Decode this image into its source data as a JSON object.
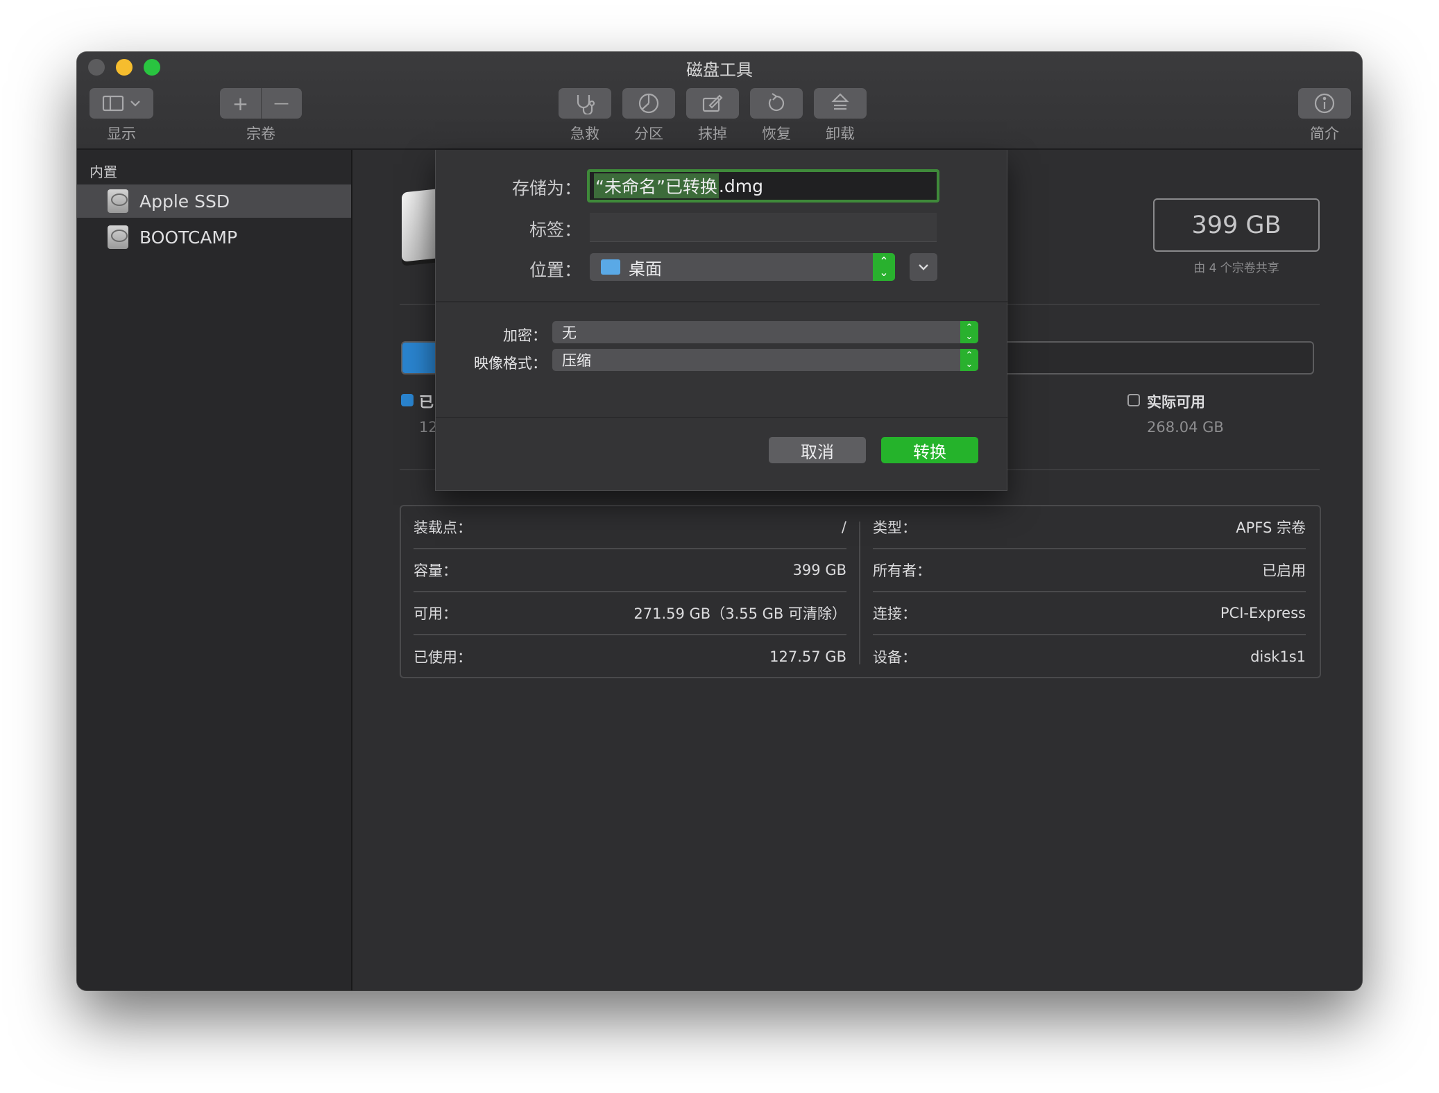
{
  "window": {
    "title": "磁盘工具"
  },
  "toolbar": {
    "view_label": "显示",
    "volume_label": "宗卷",
    "firstaid_label": "急救",
    "partition_label": "分区",
    "erase_label": "抹掉",
    "restore_label": "恢复",
    "unmount_label": "卸载",
    "info_label": "简介",
    "add_glyph": "+",
    "remove_glyph": "—"
  },
  "sidebar": {
    "section": "内置",
    "items": [
      {
        "label": "Apple SSD",
        "selected": true
      },
      {
        "label": "BOOTCAMP",
        "selected": false
      }
    ]
  },
  "volume": {
    "capacity": "399 GB",
    "shared_note": "由 4 个宗卷共享",
    "usage_fraction": 0.32,
    "used_partial": "已",
    "used_value_partial": "12",
    "available_label": "实际可用",
    "available_value": "268.04 GB",
    "colors": {
      "used": "#2a84cf"
    }
  },
  "info": {
    "left": [
      {
        "label": "装载点：",
        "value": "/"
      },
      {
        "label": "容量：",
        "value": "399 GB"
      },
      {
        "label": "可用：",
        "value": "271.59 GB（3.55 GB 可清除）"
      },
      {
        "label": "已使用：",
        "value": "127.57 GB"
      }
    ],
    "right": [
      {
        "label": "类型：",
        "value": "APFS 宗卷"
      },
      {
        "label": "所有者：",
        "value": "已启用"
      },
      {
        "label": "连接：",
        "value": "PCI-Express"
      },
      {
        "label": "设备：",
        "value": "disk1s1"
      }
    ]
  },
  "dialog": {
    "saveas_label": "存储为：",
    "saveas_selected": "“未命名”已转换",
    "saveas_ext": ".dmg",
    "tags_label": "标签：",
    "tags_value": "",
    "location_label": "位置：",
    "location_value": "桌面",
    "encryption_label": "加密：",
    "encryption_value": "无",
    "format_label": "映像格式：",
    "format_value": "压缩",
    "cancel_label": "取消",
    "convert_label": "转换",
    "accent": "#25b32b"
  }
}
